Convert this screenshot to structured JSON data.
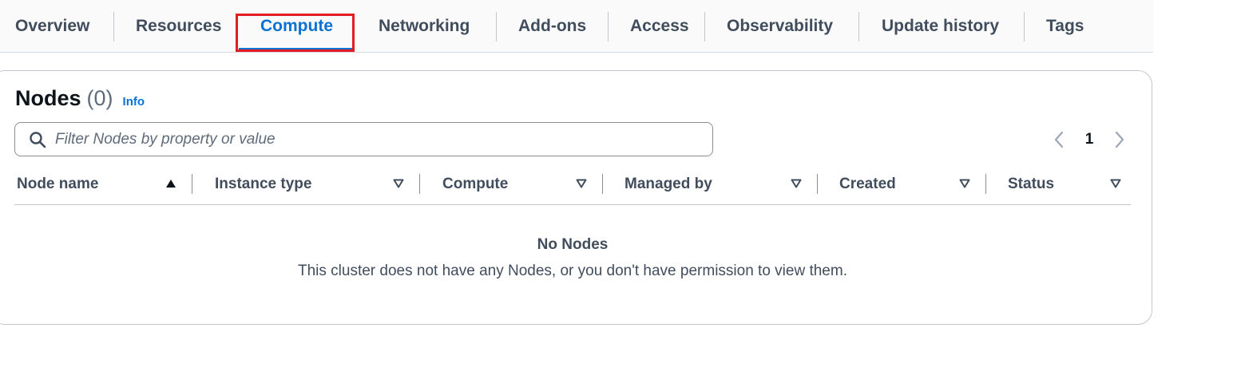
{
  "tabs": [
    {
      "label": "Overview"
    },
    {
      "label": "Resources"
    },
    {
      "label": "Compute",
      "active": true
    },
    {
      "label": "Networking"
    },
    {
      "label": "Add-ons"
    },
    {
      "label": "Access"
    },
    {
      "label": "Observability"
    },
    {
      "label": "Update history"
    },
    {
      "label": "Tags"
    }
  ],
  "nodes_panel": {
    "title": "Nodes",
    "count": "(0)",
    "info_link": "Info",
    "search_placeholder": "Filter Nodes by property or value",
    "search_value": "",
    "pagination": {
      "current_page": "1"
    },
    "columns": [
      {
        "label": "Node name",
        "sort": "ascending"
      },
      {
        "label": "Instance type",
        "sort": "none"
      },
      {
        "label": "Compute",
        "sort": "none"
      },
      {
        "label": "Managed by",
        "sort": "none"
      },
      {
        "label": "Created",
        "sort": "none"
      },
      {
        "label": "Status",
        "sort": "none"
      }
    ],
    "empty_state": {
      "title": "No Nodes",
      "message": "This cluster does not have any Nodes, or you don't have permission to view them."
    }
  },
  "icons": {
    "search": "search-icon",
    "prev": "chevron-left-icon",
    "next": "chevron-right-icon",
    "sort_asc": "sort-ascending-icon",
    "sort_none": "sort-descending-outline-icon"
  },
  "colors": {
    "accent": "#0972d3",
    "highlight_box": "#e31b23",
    "text_primary": "#0f141a",
    "text_secondary": "#414d5c",
    "muted": "#5f6b7a"
  }
}
